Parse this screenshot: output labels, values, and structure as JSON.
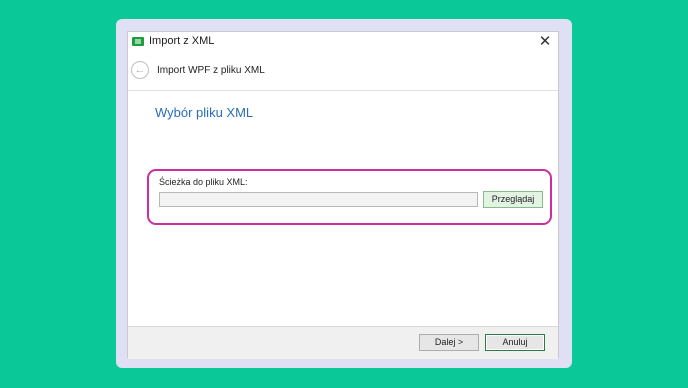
{
  "window": {
    "title": "Import z XML",
    "close_glyph": "✕",
    "app_icon": "green-folder-icon"
  },
  "nav": {
    "back_glyph": "←",
    "title": "Import WPF z pliku XML"
  },
  "page": {
    "heading": "Wybór pliku XML"
  },
  "file_path": {
    "label": "Ścieżka do pliku XML:",
    "value": "",
    "browse_label": "Przeglądaj"
  },
  "footer": {
    "next_label": "Dalej >",
    "cancel_label": "Anuluj"
  },
  "colors": {
    "background": "#0ac898",
    "highlight": "#cc2ea0",
    "heading": "#2a6db5"
  }
}
